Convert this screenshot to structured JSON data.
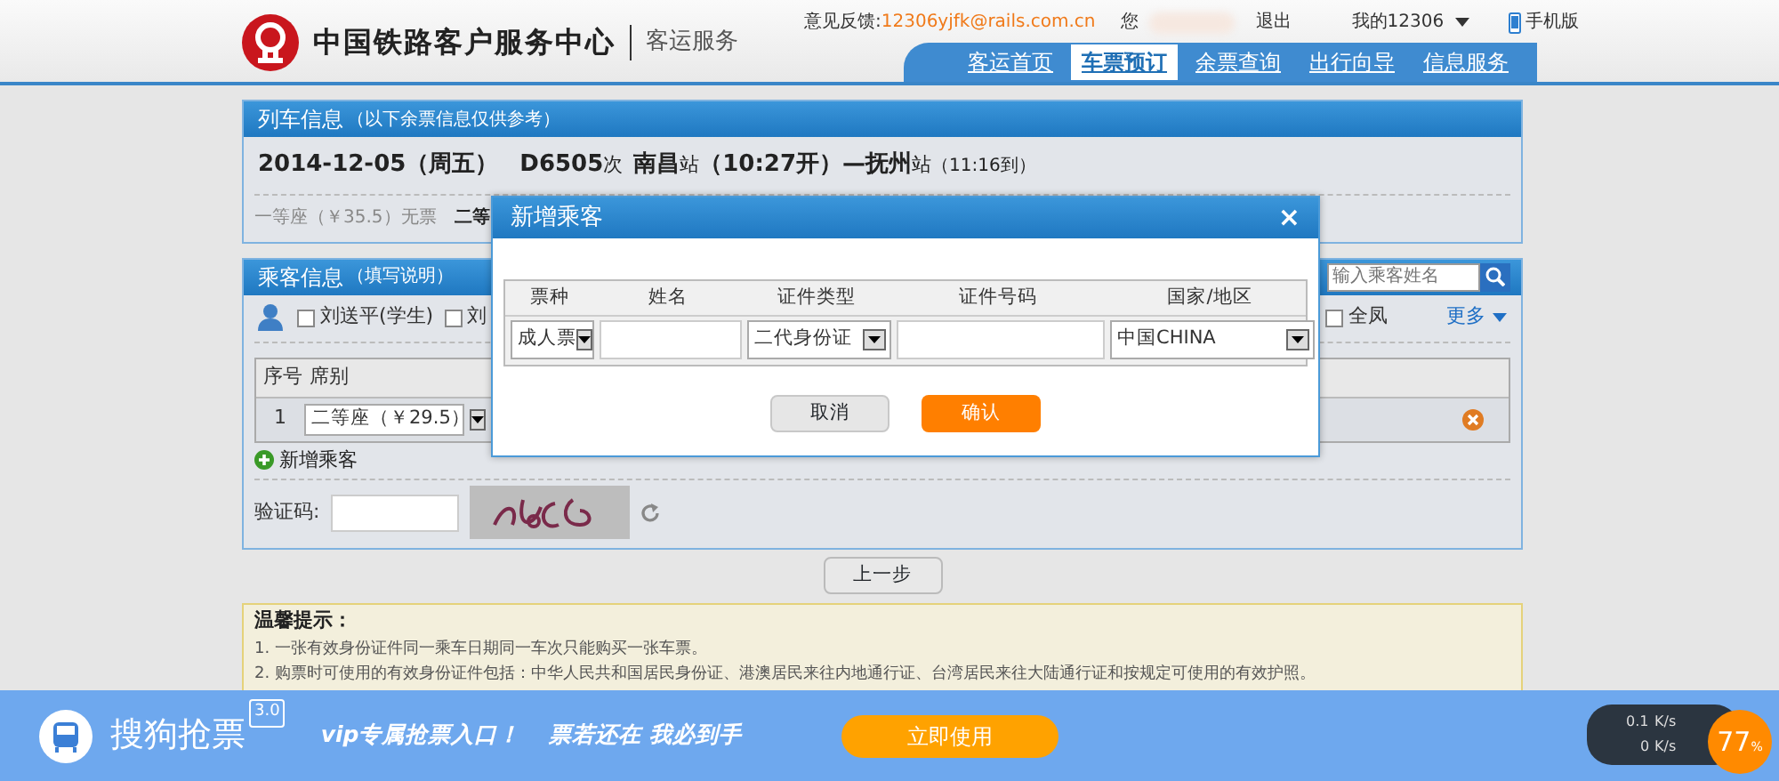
{
  "header": {
    "site_title": "中国铁路客户服务中心",
    "subtitle": "客运服务",
    "feedback_label": "意见反馈:",
    "feedback_email": "12306yjfk@rails.com.cn",
    "greeting": "您",
    "logout": "退出",
    "account": "我的12306",
    "mobile": "手机版",
    "nav": [
      {
        "label": "客运首页",
        "selected": false
      },
      {
        "label": "车票预订",
        "selected": true
      },
      {
        "label": "余票查询",
        "selected": false
      },
      {
        "label": "出行向导",
        "selected": false
      },
      {
        "label": "信息服务",
        "selected": false
      }
    ]
  },
  "train_info": {
    "title": "列车信息",
    "note": "（以下余票信息仅供参考）",
    "date": "2014-12-05（周五）",
    "train": "D6505",
    "train_suffix": "次",
    "from": "南昌",
    "from_suffix": "站",
    "depart": "（10:27开）—",
    "to": "抚州",
    "to_suffix": "站",
    "arrive": "（11:16到）",
    "seats": [
      {
        "text": "一等座（￥35.5）无票",
        "available": false
      },
      {
        "text": "二等",
        "available": true
      }
    ]
  },
  "passengers": {
    "title": "乘客信息",
    "note": "（填写说明）",
    "search": {
      "placeholder": "输入乘客姓名"
    },
    "contacts": [
      {
        "name": "刘送平(学生)",
        "checked": false
      },
      {
        "name": "刘",
        "checked": false
      },
      {
        "name": "全凤",
        "checked": false
      }
    ],
    "more": "更多",
    "columns": [
      "序号",
      "席别"
    ],
    "rows": [
      {
        "index": "1",
        "seat": "二等座（￥29.5）"
      }
    ],
    "add": "新增乘客",
    "captcha_label": "验证码:"
  },
  "back_button": "上一步",
  "tips": {
    "title": "温馨提示：",
    "items": [
      "1. 一张有效身份证件同一乘车日期同一车次只能购买一张车票。",
      "2. 购票时可使用的有效身份证件包括：中华人民共和国居民身份证、港澳居民来往内地通行证、台湾居民来往大陆通行证和按规定可使用的有效护照。"
    ]
  },
  "dialog": {
    "title": "新增乘客",
    "close": "×",
    "columns": [
      "票种",
      "姓名",
      "证件类型",
      "证件号码",
      "国家/地区"
    ],
    "ticket_type": "成人票",
    "id_type": "二代身份证",
    "country": "中国CHINA",
    "cancel": "取消",
    "confirm": "确认"
  },
  "banner": {
    "brand": "搜狗抢票",
    "version": "3.0",
    "slogan": "vip专属抢票入口！",
    "slogan2": "票若还在 我必到手",
    "cta": "立即使用"
  },
  "widget": {
    "up": "0.1",
    "up_unit": "K/s",
    "down": "0",
    "down_unit": "K/s",
    "percent": "77",
    "percent_sign": "%"
  }
}
